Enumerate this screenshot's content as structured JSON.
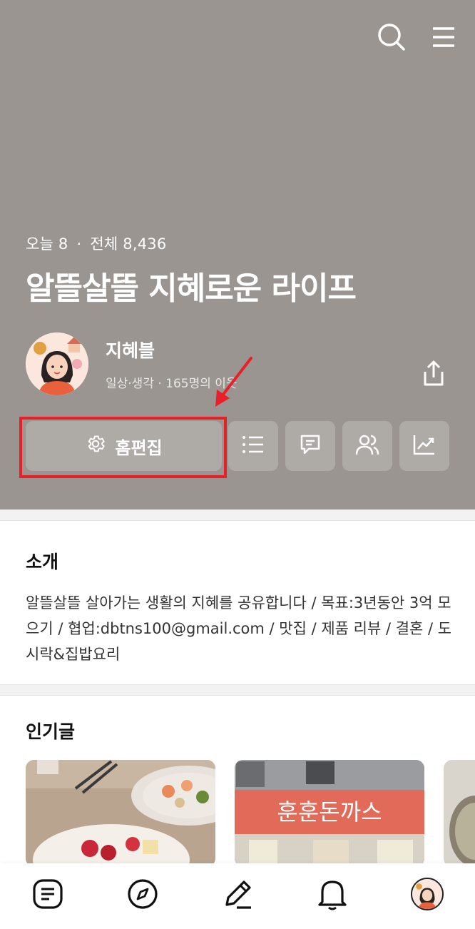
{
  "header": {
    "stats_today": "오늘 8",
    "stats_separator": "·",
    "stats_total": "전체 8,436",
    "blog_title": "알뜰살뜰 지혜로운 라이프"
  },
  "profile": {
    "name": "지혜블",
    "meta": "일상·생각 · 165명의 이웃"
  },
  "actions": {
    "home_edit_label": "홈편집"
  },
  "intro": {
    "title": "소개",
    "text": "알뜰살뜰 살아가는 생활의 지혜를 공유합니다 / 목표:3년동안 3억 모으기 / 협업:dbtns100@gmail.com / 맛집 / 제품 리뷰 / 결혼 / 도시락&집밥요리"
  },
  "popular": {
    "title": "인기글",
    "cards": [
      {
        "sign_text": ""
      },
      {
        "sign_text": "훈훈돈까스"
      },
      {
        "sign_text": ""
      }
    ]
  },
  "icons": {
    "top_right": [
      "search-icon",
      "menu-icon"
    ],
    "actions": [
      "settings-icon",
      "list-icon",
      "comment-icon",
      "neighbors-icon",
      "stats-icon"
    ],
    "tabbar": [
      "feed-icon",
      "compass-icon",
      "write-icon",
      "bell-icon",
      "profile-avatar"
    ]
  },
  "colors": {
    "hero_bg": "#9a9590",
    "button_bg": "#aeaaa5",
    "highlight": "#e8202a"
  }
}
